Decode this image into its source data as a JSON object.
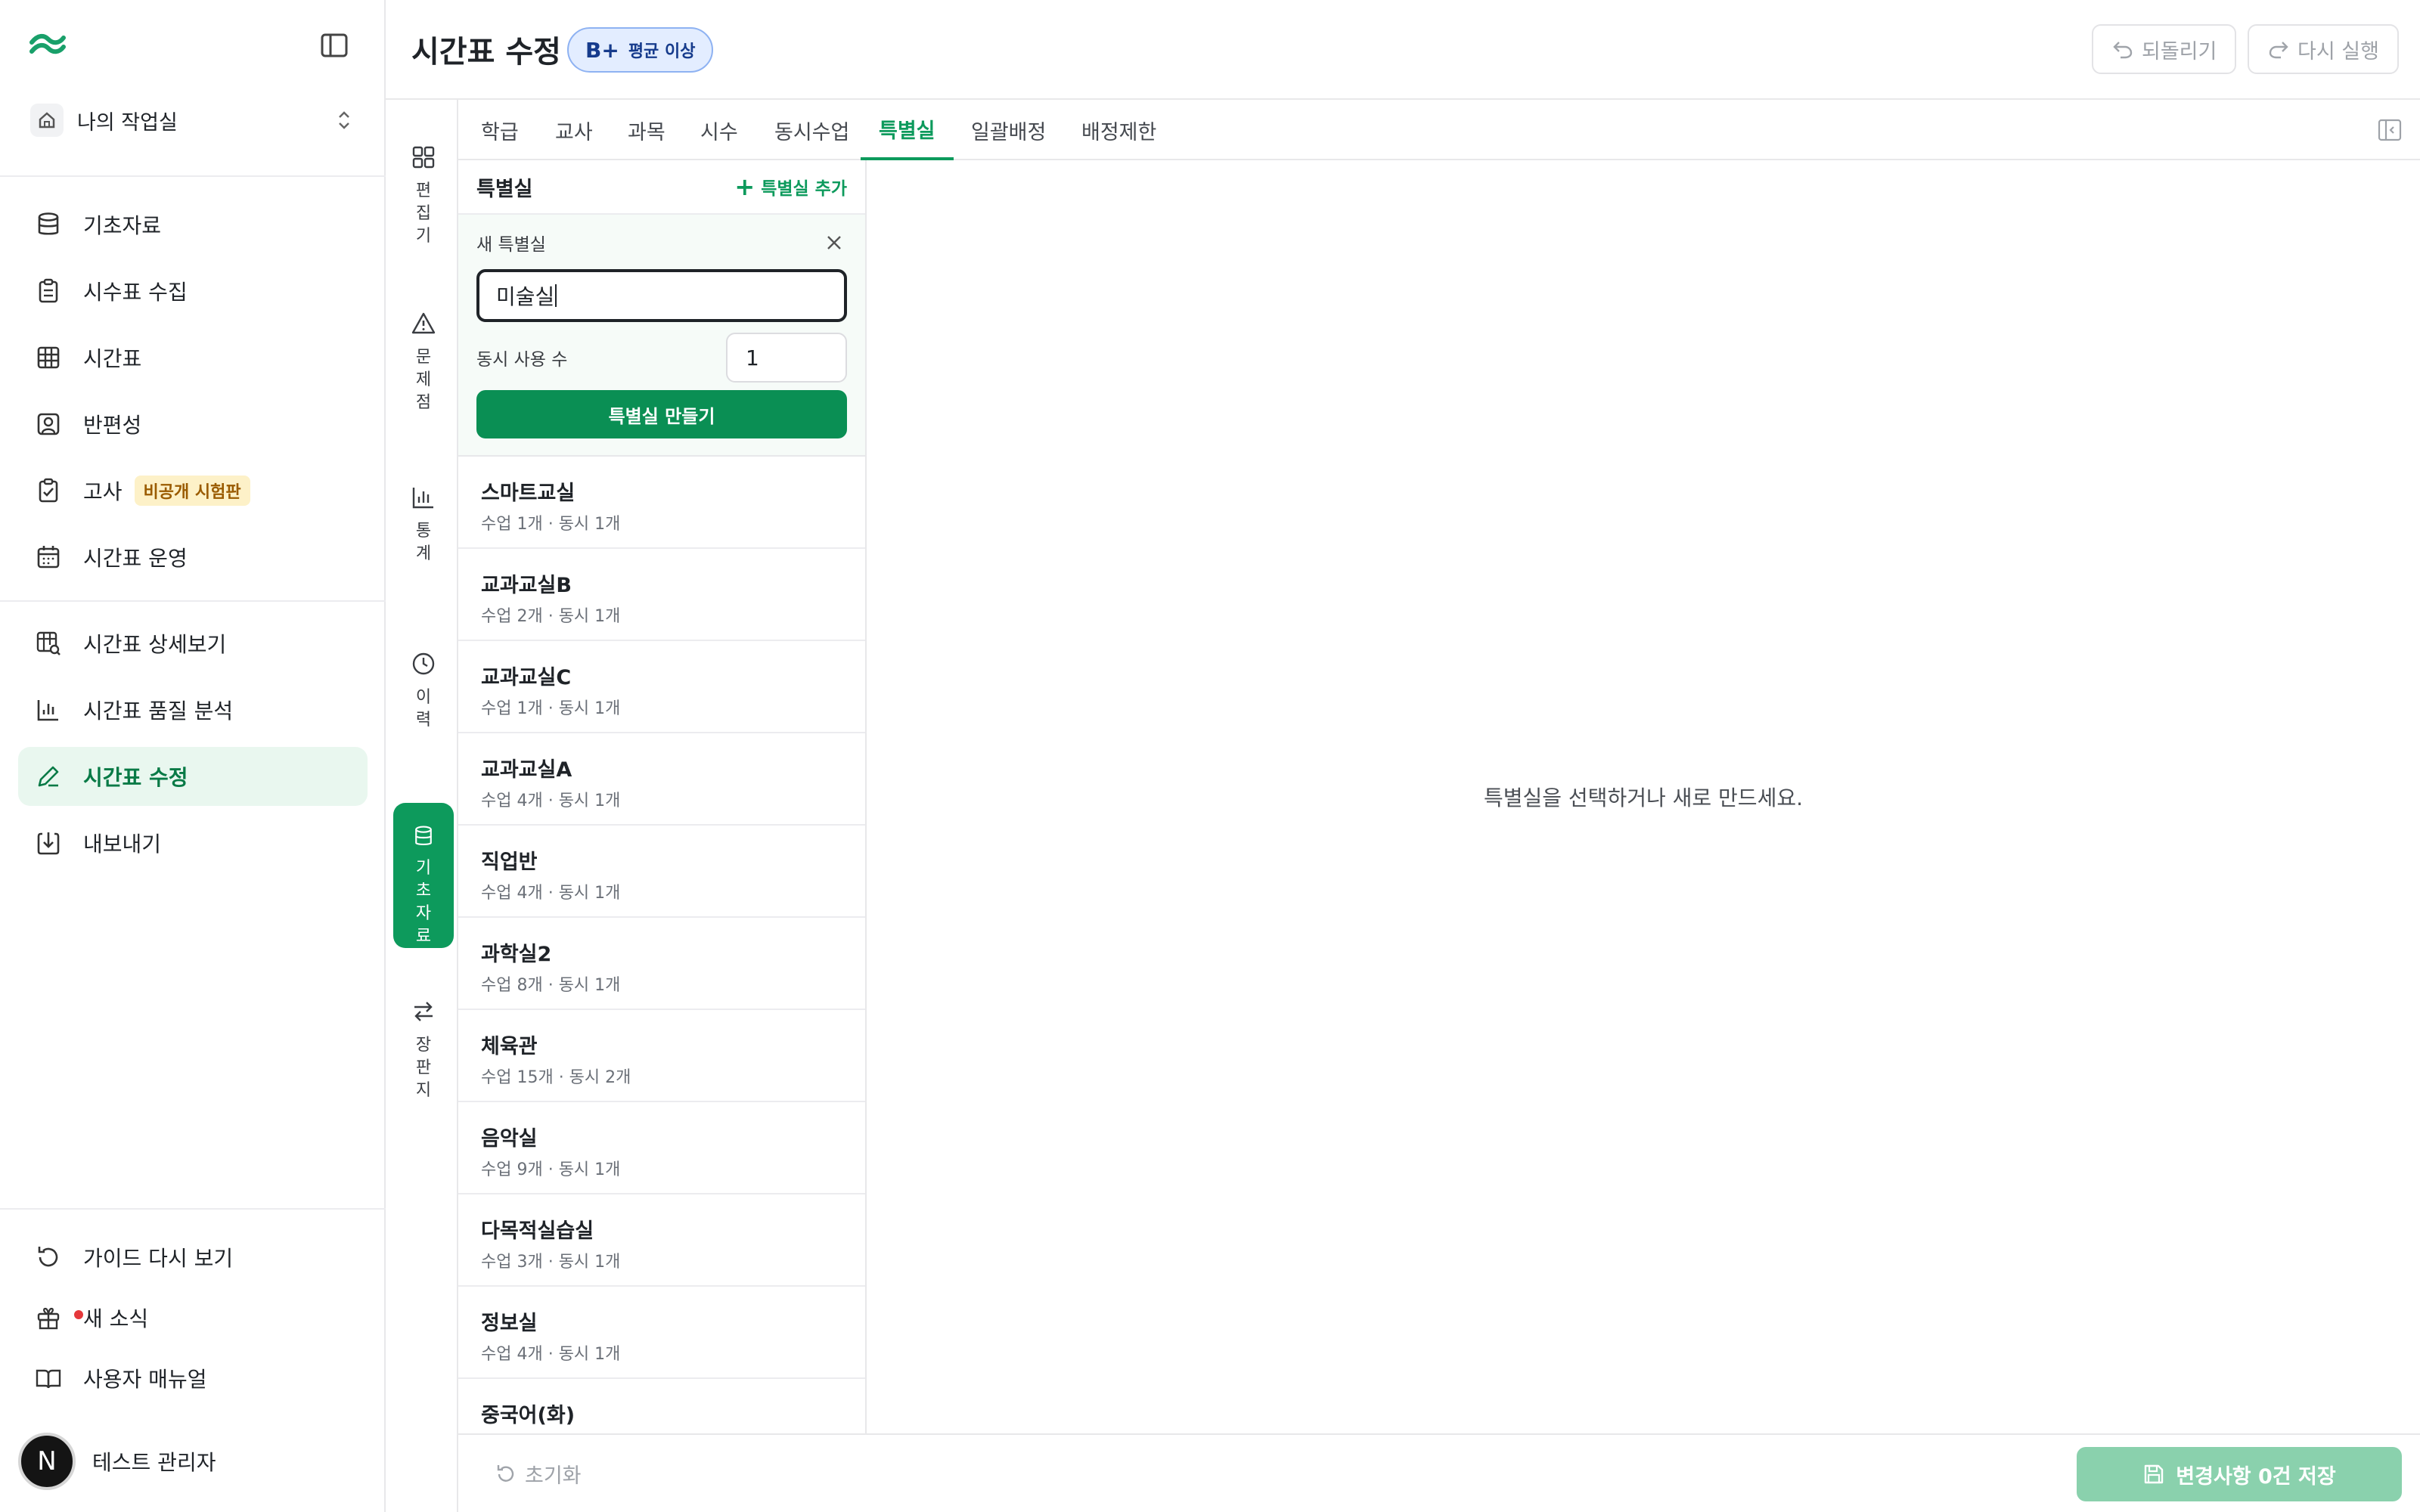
{
  "sidebar": {
    "workspace": "나의 작업실",
    "nav": [
      {
        "label": "기초자료",
        "icon": "database-icon"
      },
      {
        "label": "시수표 수집",
        "icon": "clipboard-list-icon"
      },
      {
        "label": "시간표",
        "icon": "grid-icon"
      },
      {
        "label": "반편성",
        "icon": "user-square-icon"
      },
      {
        "label": "고사",
        "icon": "clipboard-check-icon",
        "badge": "비공개 시험판"
      },
      {
        "label": "시간표 운영",
        "icon": "calendar-icon"
      },
      {
        "label": "시간표 상세보기",
        "icon": "grid-search-icon"
      },
      {
        "label": "시간표 품질 분석",
        "icon": "bar-chart-icon"
      },
      {
        "label": "시간표 수정",
        "icon": "pen-icon",
        "active": true
      },
      {
        "label": "내보내기",
        "icon": "download-icon"
      }
    ],
    "bottom": [
      {
        "label": "가이드 다시 보기",
        "icon": "rotate-ccw-icon"
      },
      {
        "label": "새 소식",
        "icon": "gift-icon"
      },
      {
        "label": "사용자 매뉴얼",
        "icon": "book-open-icon"
      }
    ],
    "user": {
      "initial": "N",
      "name": "테스트 관리자"
    }
  },
  "header": {
    "title": "시간표 수정",
    "grade": "B+",
    "grade_text": "평균 이상",
    "undo": "되돌리기",
    "redo": "다시 실행"
  },
  "rail": [
    {
      "chars": [
        "편",
        "집",
        "기"
      ],
      "icon": "layout-grid-icon"
    },
    {
      "chars": [
        "문",
        "제",
        "점"
      ],
      "icon": "alert-triangle-icon"
    },
    {
      "chars": [
        "통",
        "계"
      ],
      "icon": "bar-chart-icon"
    },
    {
      "chars": [
        "이",
        "력"
      ],
      "icon": "clock-icon"
    },
    {
      "chars": [
        "기",
        "초",
        "자",
        "료"
      ],
      "icon": "database-icon",
      "active": true
    },
    {
      "chars": [
        "장",
        "판",
        "지"
      ],
      "icon": "arrows-swap-icon"
    }
  ],
  "tabs": [
    "학급",
    "교사",
    "과목",
    "시수",
    "동시수업",
    "특별실",
    "일괄배정",
    "배정제한"
  ],
  "active_tab": "특별실",
  "list": {
    "title": "특별실",
    "add_label": "특별실 추가",
    "form": {
      "label": "새 특별실",
      "name_value": "미술실",
      "concurrent_label": "동시 사용 수",
      "concurrent_value": "1",
      "create_label": "특별실 만들기"
    },
    "rooms": [
      {
        "name": "스마트교실",
        "meta": "수업 1개 · 동시 1개"
      },
      {
        "name": "교과교실B",
        "meta": "수업 2개 · 동시 1개"
      },
      {
        "name": "교과교실C",
        "meta": "수업 1개 · 동시 1개"
      },
      {
        "name": "교과교실A",
        "meta": "수업 4개 · 동시 1개"
      },
      {
        "name": "직업반",
        "meta": "수업 4개 · 동시 1개"
      },
      {
        "name": "과학실2",
        "meta": "수업 8개 · 동시 1개"
      },
      {
        "name": "체육관",
        "meta": "수업 15개 · 동시 2개"
      },
      {
        "name": "음악실",
        "meta": "수업 9개 · 동시 1개"
      },
      {
        "name": "다목적실습실",
        "meta": "수업 3개 · 동시 1개"
      },
      {
        "name": "정보실",
        "meta": "수업 4개 · 동시 1개"
      },
      {
        "name": "중국어(화)",
        "meta": ""
      }
    ]
  },
  "detail": {
    "empty": "특별실을 선택하거나 새로 만드세요."
  },
  "footer": {
    "reset": "초기화",
    "save": "변경사항 0건 저장"
  },
  "colors": {
    "accent": "#0d9a5c",
    "active_bg": "#e9f7ef",
    "badge_bg": "#fdf1c8"
  }
}
